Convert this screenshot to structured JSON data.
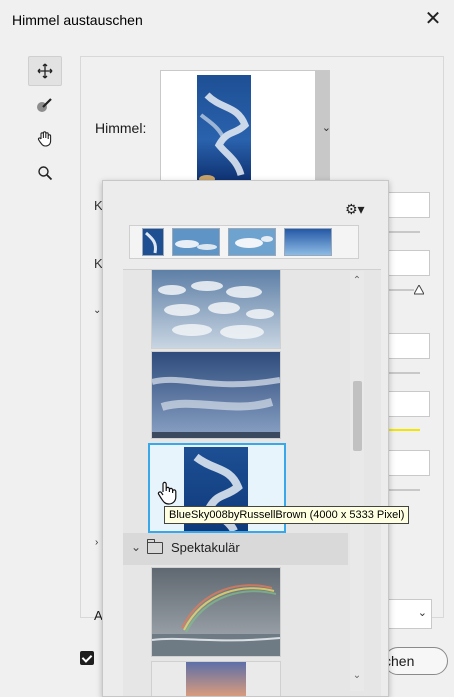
{
  "window": {
    "title": "Himmel austauschen",
    "close_icon": "close-icon"
  },
  "tools": [
    {
      "name": "move-tool-icon"
    },
    {
      "name": "sky-brush-tool-icon"
    },
    {
      "name": "hand-tool-icon"
    },
    {
      "name": "zoom-tool-icon"
    }
  ],
  "sky": {
    "label": "Himmel:"
  },
  "partial_labels": {
    "k1": "K",
    "k2": "K",
    "a": "A"
  },
  "popup": {
    "settings_icon": "gear-icon",
    "category": {
      "label": "Spektakulär"
    },
    "tooltip": "BlueSky008byRussellBrown (4000 x 5333 Pixel)"
  },
  "footer": {
    "ok_button_partial": "chen"
  },
  "colors": {
    "selection": "#3aa8e8",
    "tooltip_bg": "#ffffe1",
    "accent_yellow": "#f2e600"
  }
}
